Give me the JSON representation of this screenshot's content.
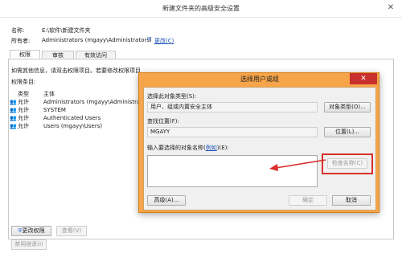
{
  "background_dialog": {
    "title": "新建文件夹的高级安全设置",
    "name_label": "名称:",
    "name_value": "E:\\软件\\新建文件夹",
    "owner_label": "所有者:",
    "owner_value": "Administrators (mgayy\\Administrators)",
    "change_link": "更改(C)",
    "tabs": [
      {
        "label": "权限"
      },
      {
        "label": "审核"
      },
      {
        "label": "有效访问"
      }
    ],
    "info_text": "如需其他信息，请双击权限项目。若要修改权限项目，请选择该项目并单击\"编辑\"(如果可用)。",
    "perm_entries_label": "权限条目:",
    "table_headers": {
      "type": "类型",
      "principal": "主体"
    },
    "rows": [
      {
        "type": "允许",
        "principal": "Administrators (mgayy\\Administrat..."
      },
      {
        "type": "允许",
        "principal": "SYSTEM"
      },
      {
        "type": "允许",
        "principal": "Authenticated Users"
      },
      {
        "type": "允许",
        "principal": "Users (mgayy\\Users)"
      }
    ],
    "change_perm_button": "更改权限",
    "view_button": "查看(V)",
    "disable_inherit_button": "禁用继承(I)"
  },
  "select_dialog": {
    "title": "选择用户或组",
    "object_type_label": "选择此对象类型(S):",
    "object_type_value": "用户、组或内置安全主体",
    "object_type_button": "对象类型(O)...",
    "location_label": "查找位置(F):",
    "location_value": "MGAYY",
    "location_button": "位置(L)...",
    "names_label_prefix": "输入要选择的对象名称(",
    "names_label_link": "例如",
    "names_label_suffix": ")(E):",
    "check_names_button": "检查名称(C)",
    "advanced_button": "高级(A)...",
    "ok_button": "确定",
    "cancel_button": "取消"
  },
  "colors": {
    "dialog_frame": "#f7a54a",
    "highlight": "#d9312b",
    "close_button": "#c8302b"
  }
}
